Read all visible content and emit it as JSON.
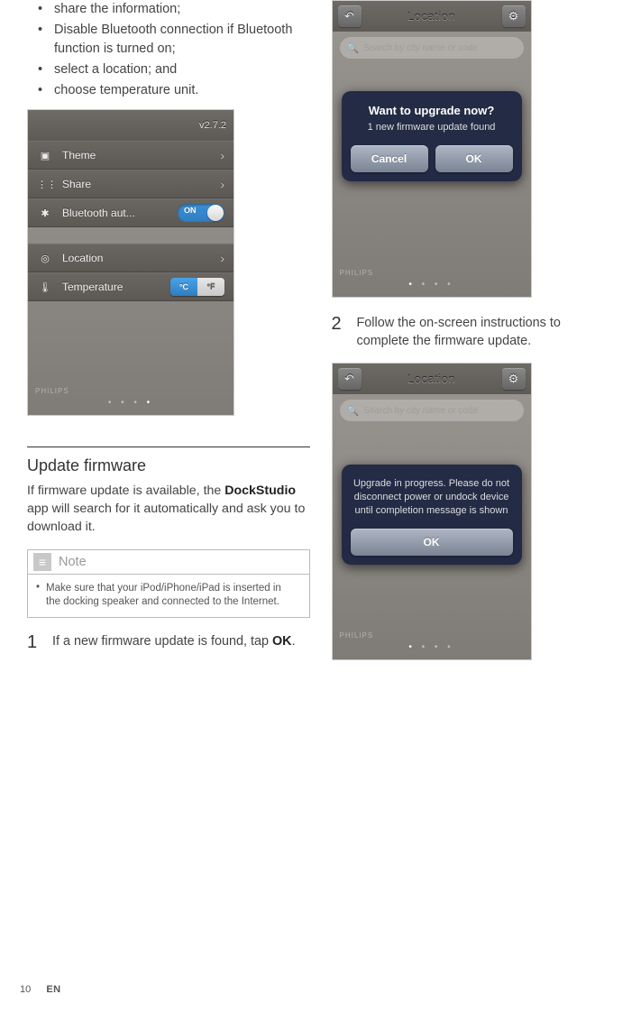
{
  "left": {
    "bullets": [
      "share the information;",
      "Disable Bluetooth connection if Bluetooth function is turned on;",
      "select a location; and",
      "choose temperature unit."
    ],
    "settings_screenshot": {
      "version": "v2.7.2",
      "rows": {
        "theme": {
          "label": "Theme"
        },
        "share": {
          "label": "Share"
        },
        "bluetooth": {
          "label": "Bluetooth aut...",
          "toggle_on": "ON"
        },
        "location": {
          "label": "Location"
        },
        "temperature": {
          "label": "Temperature",
          "unit_c": "°C",
          "unit_f": "°F"
        }
      },
      "brand": "PHILIPS",
      "pager": "• • • •"
    },
    "section_heading": "Update firmware",
    "section_body_pre": "If firmware update is available, the ",
    "section_body_bold": "DockStudio",
    "section_body_post": " app will search for it automatically and ask you to download it.",
    "note_label": "Note",
    "note_body": "Make sure that your iPod/iPhone/iPad is inserted in the docking speaker and connected to the Internet.",
    "step1_num": "1",
    "step1_text_pre": "If a new firmware update is found, tap ",
    "step1_text_bold": "OK",
    "step1_text_post": "."
  },
  "right": {
    "upgrade_screenshot": {
      "nav_title": "Location",
      "search_placeholder": "Search by city name or code",
      "modal_title": "Want to upgrade now?",
      "modal_msg": "1 new firmware update found",
      "btn_cancel": "Cancel",
      "btn_ok": "OK",
      "brand": "PHILIPS",
      "pager": "• • • •"
    },
    "step2_num": "2",
    "step2_text": "Follow the on-screen instructions to complete the firmware update.",
    "progress_screenshot": {
      "nav_title": "Location",
      "search_placeholder": "Search by city name or code",
      "modal_msg": "Upgrade in progress. Please do not disconnect power or undock device until completion message is shown",
      "btn_ok": "OK",
      "brand": "PHILIPS",
      "pager": "• • • •"
    }
  },
  "footer": {
    "page_num": "10",
    "lang": "EN"
  }
}
